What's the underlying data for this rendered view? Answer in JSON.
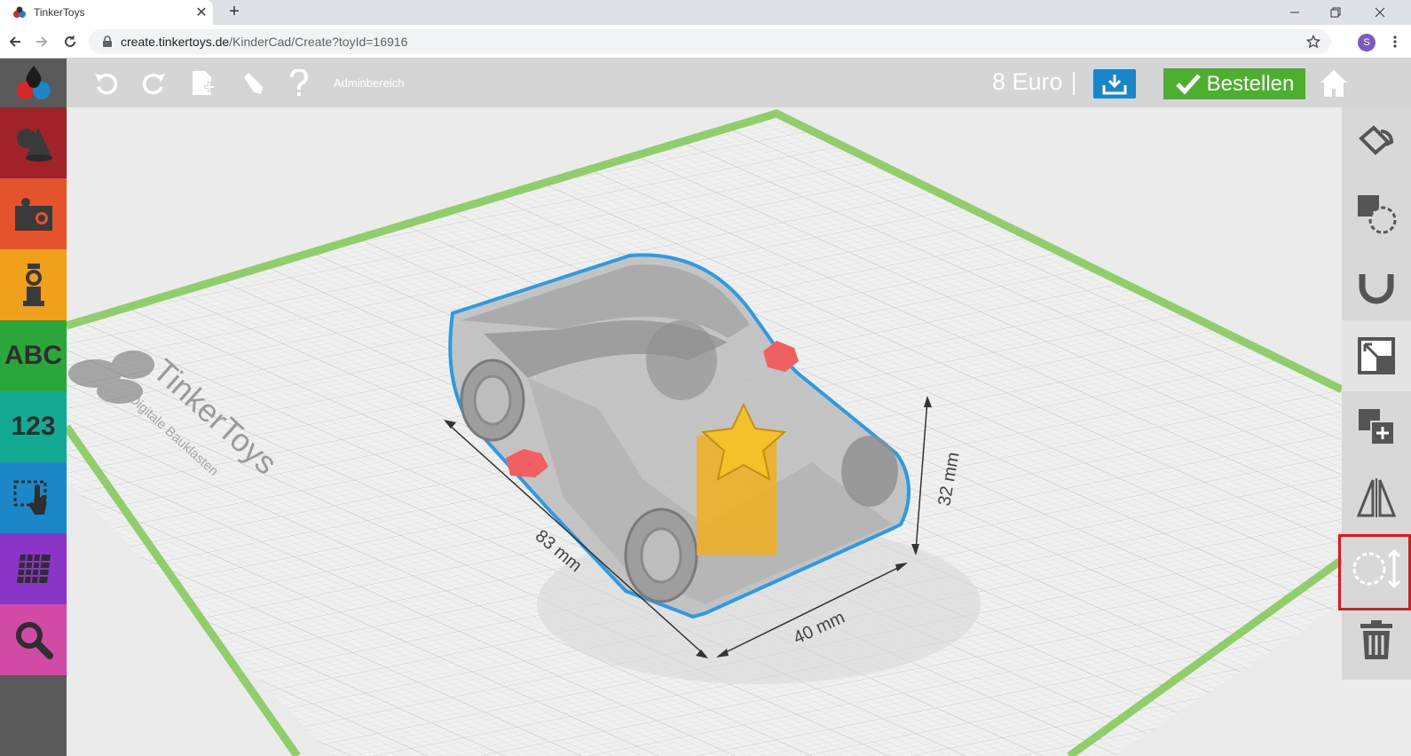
{
  "browser": {
    "tab_title": "TinkerToys",
    "tab_close": "✕",
    "new_tab": "+",
    "url_host": "create.tinkertoys.de",
    "url_path": "/KinderCad/Create?toyId=16916",
    "profile_initial": "S"
  },
  "header": {
    "admin_link": "Adminbereich",
    "price": "8 Euro",
    "order_label": "Bestellen"
  },
  "sidebar": {
    "categories": [
      {
        "name": "shapes",
        "color": "#a2222a"
      },
      {
        "name": "parts",
        "color": "#e5532d"
      },
      {
        "name": "figures",
        "color": "#f0a01b"
      },
      {
        "name": "letters",
        "label": "ABC",
        "color": "#2aa63b"
      },
      {
        "name": "numbers",
        "label": "123",
        "color": "#13a992"
      },
      {
        "name": "select",
        "color": "#1b86c8"
      },
      {
        "name": "grid",
        "color": "#8a34c8"
      },
      {
        "name": "search",
        "color": "#d14aa6"
      }
    ]
  },
  "canvas": {
    "watermark_title": "TinkerToys",
    "watermark_subtitle": "Digitale Bauklasten",
    "dim_length": "83 mm",
    "dim_width": "40 mm",
    "dim_height": "32 mm"
  },
  "tools": [
    "paint",
    "hole",
    "magnet",
    "scale",
    "duplicate",
    "mirror",
    "lift",
    "delete"
  ],
  "colors": {
    "order_green": "#4caf2e",
    "download_blue": "#1a86c8",
    "selection_blue": "#2d9be4",
    "plane_green": "#8fce6a",
    "highlight_red": "#e3171b"
  }
}
